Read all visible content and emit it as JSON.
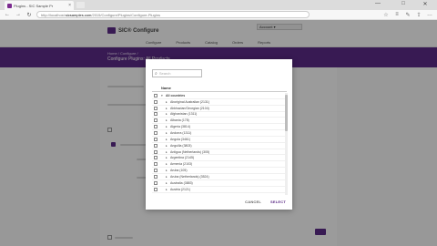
{
  "browser": {
    "tab_title": "Plugins - SIC Sample Pr",
    "tab_close": "×",
    "new_tab": "+",
    "url_prefix": "http://localhost:",
    "url_host": "sicsamples.com",
    "url_path": "/2015/Configure/Plugins/Configure-Plugins",
    "window_controls": [
      "—",
      "□",
      "✕"
    ]
  },
  "site": {
    "logo_text": "SIC® Configure",
    "nav": [
      "Configure",
      "Products",
      "Catalog",
      "Orders",
      "Reports"
    ],
    "user_label": "Account ▾",
    "breadcrumb": "Home / Configure /",
    "page_title": "Configure Plugins: All Products"
  },
  "modal": {
    "search_placeholder": "Search",
    "column_header": "Name",
    "items": [
      {
        "label": "All countries",
        "root": true
      },
      {
        "label": "Aboriginal Australian (2131)"
      },
      {
        "label": "Abkhazian/Georgian (2104)"
      },
      {
        "label": "Afghanistan (1311)"
      },
      {
        "label": "Albania (178)"
      },
      {
        "label": "Algeria (3814)"
      },
      {
        "label": "Andorra (1311)"
      },
      {
        "label": "Angola (3461)"
      },
      {
        "label": "Anguilla (3803)"
      },
      {
        "label": "Antigua (Netherlands) (305)"
      },
      {
        "label": "Argentina (2145)"
      },
      {
        "label": "Armenia (2103)"
      },
      {
        "label": "Aruba (105)"
      },
      {
        "label": "Aruba (Netherlands) (3524)"
      },
      {
        "label": "Australia (3883)"
      },
      {
        "label": "Austria (2121)"
      }
    ],
    "cancel_label": "CANCEL",
    "select_label": "SELECT"
  }
}
